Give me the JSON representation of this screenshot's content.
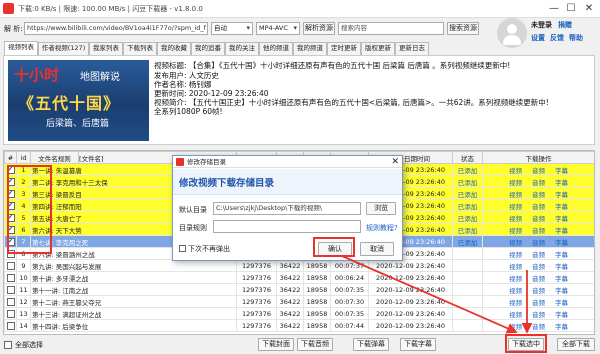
{
  "titlebar": {
    "title": "下载:0 KB/s | 限速: 100.00 MB/s | 闪豆下载器 - v1.8.0.0",
    "min": "—",
    "max": "☐",
    "close": "✕"
  },
  "urlbar": {
    "parse_label": "解 析:",
    "url_value": "https://www.bilibili.com/video/BV1oa4i1F77o/?spm_id_f",
    "quality": "自动",
    "codec": "MP4-AVC",
    "parse_button": "解析资源",
    "search_placeholder": "搜索内容",
    "search_button": "搜索资源"
  },
  "user": {
    "status": "未登录",
    "register": "捐赠",
    "settings": "设置",
    "feedback": "反馈",
    "help": "帮助"
  },
  "tabs": [
    "视频列表",
    "作者视频(127)",
    "我家列表",
    "下载列表",
    "我的收藏",
    "我的追番",
    "我的关注",
    "他的频道",
    "我的频道",
    "定时更新",
    "版权更新",
    "更新日志"
  ],
  "info": {
    "cover_line1": "十小时",
    "cover_line2": "地图解说",
    "cover_line3": "《五代十国》",
    "cover_line4": "后梁篇、后唐篇",
    "lines": [
      "视频标题: 【合集】《五代十国》十小时详细还原有声有色的五代十国 后梁篇 后唐篇 。系列视频继续更新中!",
      "发布用户: 人文历史",
      "作者名称: 杨钊娜",
      "更新时间: 2020-12-09 23:26:40",
      "视频简介: 【五代十国正史】十小时详细还原有声有色的五代十国<后梁篇, 后唐篇>。一共62讲。系列视频继续更新中!",
      "全系列1080P 60帧!"
    ]
  },
  "table": {
    "headers": [
      "#",
      "id",
      "文件名规则",
      "[文件名]",
      "",
      "",
      "",
      "",
      "更新日期时间",
      "状态",
      "下载操作"
    ],
    "rows": [
      {
        "checked": true,
        "id": "1",
        "name": "第一讲: 朱温篡唐",
        "c1": "",
        "c2": "",
        "c3": "",
        "c4": "",
        "date": "2020-12-09 23:26:40",
        "status": "已添加",
        "a1": "视频",
        "a2": "音频",
        "a3": "字幕"
      },
      {
        "checked": true,
        "id": "2",
        "name": "第二讲: 李克用和十三太保",
        "c1": "",
        "c2": "",
        "c3": "",
        "c4": "",
        "date": "2020-12-09 23:26:40",
        "status": "已添加",
        "a1": "视频",
        "a2": "音频",
        "a3": "字幕"
      },
      {
        "checked": true,
        "id": "3",
        "name": "第三讲: 梁晋反目",
        "c1": "",
        "c2": "",
        "c3": "",
        "c4": "",
        "date": "2020-12-09 23:26:40",
        "status": "已添加",
        "a1": "视频",
        "a2": "音频",
        "a3": "字幕"
      },
      {
        "checked": true,
        "id": "4",
        "name": "第四讲: 汪郁而阳",
        "c1": "",
        "c2": "",
        "c3": "",
        "c4": "",
        "date": "2020-12-09 23:26:40",
        "status": "已添加",
        "a1": "视频",
        "a2": "音频",
        "a3": "字幕"
      },
      {
        "checked": true,
        "id": "5",
        "name": "第五讲: 大唐亡了",
        "c1": "",
        "c2": "",
        "c3": "",
        "c4": "",
        "date": "2020-12-09 23:26:40",
        "status": "已添加",
        "a1": "视频",
        "a2": "音频",
        "a3": "字幕"
      },
      {
        "checked": true,
        "id": "6",
        "name": "第六讲: 天下大势",
        "c1": "",
        "c2": "",
        "c3": "",
        "c4": "",
        "date": "2020-12-09 23:26:40",
        "status": "已添加",
        "a1": "视频",
        "a2": "音频",
        "a3": "字幕"
      },
      {
        "checked": true,
        "id": "7",
        "name": "第七讲: 李克用之死",
        "c1": "",
        "c2": "",
        "c3": "",
        "c4": "",
        "date": "2020-12-09 23:26:40",
        "status": "已添加",
        "a1": "视频",
        "a2": "音频",
        "a3": "字幕"
      },
      {
        "checked": false,
        "id": "8",
        "name": "第八讲: 梁晋潞州之战",
        "c1": "1297376",
        "c2": "36422",
        "c3": "18958",
        "c4": "00:07:36",
        "date": "2020-12-09 23:26:40",
        "status": "",
        "a1": "视频",
        "a2": "音频",
        "a3": "字幕"
      },
      {
        "checked": false,
        "id": "9",
        "name": "第九讲: 吴国兴起与发展",
        "c1": "1297376",
        "c2": "36422",
        "c3": "18958",
        "c4": "00:07:37",
        "date": "2020-12-09 23:26:40",
        "status": "",
        "a1": "视频",
        "a2": "音频",
        "a3": "字幕"
      },
      {
        "checked": false,
        "id": "10",
        "name": "第十讲: 多牙漂之战",
        "c1": "1297376",
        "c2": "36422",
        "c3": "18958",
        "c4": "00:06:24",
        "date": "2020-12-09 23:26:40",
        "status": "",
        "a1": "视频",
        "a2": "音频",
        "a3": "字幕"
      },
      {
        "checked": false,
        "id": "11",
        "name": "第十一讲: 江南之战",
        "c1": "1297376",
        "c2": "36422",
        "c3": "18958",
        "c4": "00:07:35",
        "date": "2020-12-09 23:26:40",
        "status": "",
        "a1": "视频",
        "a2": "音频",
        "a3": "字幕"
      },
      {
        "checked": false,
        "id": "12",
        "name": "第十二讲: 燕王篡父夺兄",
        "c1": "1297376",
        "c2": "36422",
        "c3": "18958",
        "c4": "00:07:30",
        "date": "2020-12-09 23:26:40",
        "status": "",
        "a1": "视频",
        "a2": "音频",
        "a3": "字幕"
      },
      {
        "checked": false,
        "id": "13",
        "name": "第十三讲: 满超证州之战",
        "c1": "1297376",
        "c2": "36422",
        "c3": "18958",
        "c4": "00:07:35",
        "date": "2020-12-09 23:26:40",
        "status": "",
        "a1": "视频",
        "a2": "音频",
        "a3": "字幕"
      },
      {
        "checked": false,
        "id": "14",
        "name": "第十四讲: 后梁争位",
        "c1": "1297376",
        "c2": "36422",
        "c3": "18958",
        "c4": "00:07:44",
        "date": "2020-12-09 23:26:40",
        "status": "",
        "a1": "视频",
        "a2": "音频",
        "a3": "字幕"
      }
    ]
  },
  "bottom": {
    "select_all": "全部选择",
    "dl_cover": "下载封面",
    "dl_audio": "下载音频",
    "dl_danmu": "下载弹幕",
    "dl_subtitle": "下载字幕",
    "dl_selected": "下载选中",
    "dl_all": "全部下载"
  },
  "modal": {
    "title": "修改存储目录",
    "close": "✕",
    "heading": "修改视频下载存储目录",
    "dir_label": "默认目录",
    "dir_value": "C:\\Users\\zjkj\\Desktop\\下载的视频\\",
    "browse": "浏览",
    "rule_label": "目录规则",
    "rule_value": "",
    "rule_help": "规则教程?",
    "no_popup": "下次不再弹出",
    "confirm": "确认",
    "cancel": "取消"
  },
  "colors": {
    "selected_row": "#ffff2e",
    "highlight_row": "#7fa7e6",
    "annotation": "#e8322b",
    "link": "#1a5fc1"
  }
}
